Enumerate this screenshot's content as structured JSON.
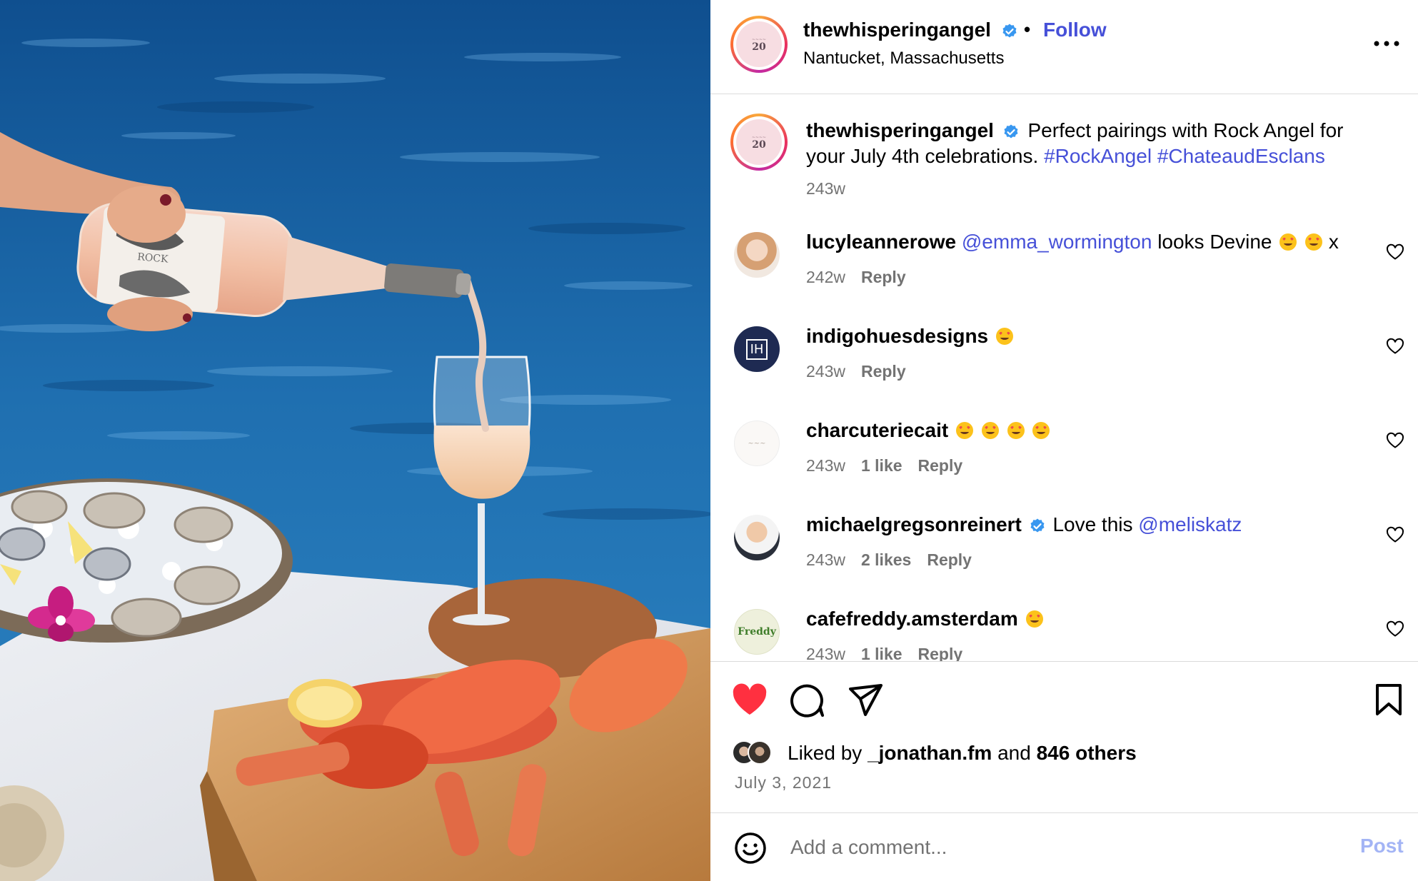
{
  "post": {
    "image_alt": "Rose wine being poured into a glass next to oysters on ice and a lobster platter by the sea",
    "bottle_label": "ROCK"
  },
  "header": {
    "avatar_text": "20",
    "username": "thewhisperingangel",
    "separator": "•",
    "follow_label": "Follow",
    "location": "Nantucket, Massachusetts",
    "more_icon": "more-horizontal-icon"
  },
  "caption": {
    "username": "thewhisperingangel",
    "text": "Perfect pairings with Rock Angel for your July 4th celebrations.",
    "hashtags": [
      "#RockAngel",
      "#ChateaudEsclans"
    ],
    "time": "243w"
  },
  "comments": [
    {
      "username": "lucyleannerowe",
      "mention": "@emma_wormington",
      "text": "looks Devine",
      "emoji_count": 2,
      "suffix": "x",
      "time": "242w",
      "likes": "",
      "reply": "Reply"
    },
    {
      "username": "indigohuesdesigns",
      "mention": "",
      "text": "",
      "emoji_count": 1,
      "suffix": "",
      "time": "243w",
      "likes": "",
      "reply": "Reply",
      "avatar_text": "IH"
    },
    {
      "username": "charcuteriecait",
      "mention": "",
      "text": "",
      "emoji_count": 4,
      "suffix": "",
      "time": "243w",
      "likes": "1 like",
      "reply": "Reply"
    },
    {
      "username": "michaelgregsonreinert",
      "verified": true,
      "text": "Love this",
      "mention": "@meliskatz",
      "emoji_count": 0,
      "suffix": "",
      "time": "243w",
      "likes": "2 likes",
      "reply": "Reply"
    },
    {
      "username": "cafefreddy.amsterdam",
      "mention": "",
      "text": "",
      "emoji_count": 1,
      "suffix": "",
      "time": "243w",
      "likes": "1 like",
      "reply": "Reply",
      "avatar_text": "Freddy"
    }
  ],
  "actions": {
    "liked_prefix": "Liked by",
    "liked_user": "_jonathan.fm",
    "liked_and": "and",
    "liked_others": "846 others",
    "date": "July 3, 2021"
  },
  "add_comment": {
    "placeholder": "Add a comment...",
    "post_label": "Post"
  },
  "colors": {
    "link": "#4650d8",
    "verified": "#3897f0",
    "like_red": "#ff3040",
    "muted": "#737373",
    "post_disabled": "#a3b4f5"
  }
}
